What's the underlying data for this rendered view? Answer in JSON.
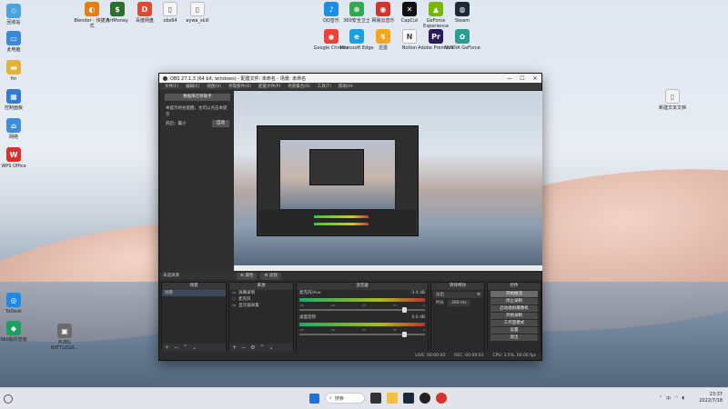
{
  "desktop": {
    "left_icons": [
      {
        "label": "回收站",
        "color": "#4aa3df",
        "glyph": "♲"
      },
      {
        "label": "此电脑",
        "color": "#3b8ad9",
        "glyph": "▭"
      },
      {
        "label": "fm",
        "color": "#e3b23c",
        "glyph": "▬"
      },
      {
        "label": "控制面板",
        "color": "#2f7bd6",
        "glyph": "▦"
      },
      {
        "label": "网络",
        "color": "#3c8fd8",
        "glyph": "⌂"
      },
      {
        "label": "WPS Office",
        "color": "#d9302c",
        "glyph": "W"
      },
      {
        "label": "ToDesk",
        "color": "#1e88e5",
        "glyph": "◎"
      },
      {
        "label": "360软件管家",
        "color": "#1aa260",
        "glyph": "◆"
      },
      {
        "label": "PUBG BATTLEGR...",
        "color": "#6b6b6b",
        "glyph": "▣"
      }
    ],
    "top_icons": [
      {
        "label": "Blender - 快捷方式",
        "color": "#e87d0d",
        "glyph": "◐"
      },
      {
        "label": "ArtMoney",
        "color": "#2c6e2c",
        "glyph": "$"
      },
      {
        "label": "百度网盘",
        "color": "#e04a2f",
        "glyph": "D"
      },
      {
        "label": "obs64",
        "color": "#f5f5f5",
        "glyph": "▯"
      },
      {
        "label": "eywa_skill",
        "color": "#f5f5f5",
        "glyph": "▯"
      }
    ],
    "center_icons_row1": [
      {
        "label": "QQ音乐",
        "color": "#1b8fe6",
        "glyph": "♪"
      },
      {
        "label": "360安全卫士",
        "color": "#32a852",
        "glyph": "⊕"
      },
      {
        "label": "网易云音乐",
        "color": "#d6322b",
        "glyph": "◉"
      },
      {
        "label": "CapCut",
        "color": "#111111",
        "glyph": "✕"
      },
      {
        "label": "GeForce Experience",
        "color": "#76b900",
        "glyph": "▲"
      },
      {
        "label": "Steam",
        "color": "#1b2838",
        "glyph": "◍"
      }
    ],
    "center_icons_row2": [
      {
        "label": "Google Chrome",
        "color": "#ea4335",
        "glyph": "◉"
      },
      {
        "label": "Microsoft Edge",
        "color": "#1ba1e2",
        "glyph": "e"
      },
      {
        "label": "迅雷",
        "color": "#f4a61d",
        "glyph": "↯"
      },
      {
        "label": "Notion",
        "color": "#ffffff",
        "glyph": "N"
      },
      {
        "label": "Adobe Premiere",
        "color": "#2a1a5c",
        "glyph": "Pr"
      },
      {
        "label": "NVIDIA GeForce",
        "color": "#2a9d8f",
        "glyph": "✿"
      }
    ],
    "right_icon": {
      "label": "新建文本文档",
      "color": "#f3f3f3",
      "glyph": "▯"
    }
  },
  "obs": {
    "title": "OBS 27.1.3 (64 bit, windows) - 配置文件: 未命名 - 场景: 未命名",
    "window_controls": [
      "—",
      "☐",
      "✕"
    ],
    "menu": [
      "文件(F)",
      "编辑(E)",
      "视图(V)",
      "停靠部件(D)",
      "配置文件(P)",
      "场景集合(S)",
      "工具(T)",
      "帮助(H)"
    ],
    "left_panel": {
      "header": "数据库迁移助手",
      "message": "本提示将会提醒，也可以点击本提示",
      "row_label": "开启：最小",
      "button": "自动"
    },
    "status_left": "未选择源",
    "scene_buttons": [
      "⚙ 属性",
      "⚙ 滤镜"
    ],
    "docks": {
      "scenes": {
        "title": "场景",
        "items": [
          "场景"
        ]
      },
      "sources": {
        "title": "来源",
        "items": [
          "屏幕录制",
          "麦克风",
          "显示器采集"
        ]
      },
      "mixer": {
        "title": "混音器",
        "channels": [
          {
            "name": "桌面音频",
            "db": "0.0 dB"
          },
          {
            "name": "麦克风/Aux",
            "db": "-3.4 dB"
          }
        ]
      },
      "transitions": {
        "title": "转场特效",
        "type": "淡出",
        "duration_label": "时长",
        "duration": "300 ms"
      },
      "controls": {
        "title": "控件",
        "buttons": [
          "开始推流",
          "停止录制",
          "启动虚拟摄像机",
          "开始录制",
          "工作室模式",
          "设置",
          "退出"
        ]
      }
    },
    "footer": {
      "live": "LIVE: 00:00:00",
      "rec": "REC: 00:00:01",
      "cpu": "CPU: 3.5%, 60.00 fps"
    }
  },
  "taskbar": {
    "search_label": "搜索",
    "time": "23:37",
    "date": "2022/7/18"
  }
}
